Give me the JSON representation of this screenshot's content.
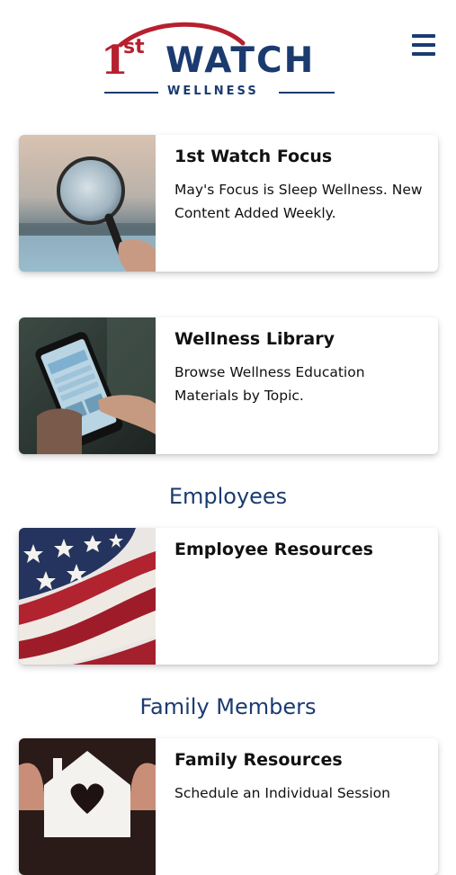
{
  "header": {
    "logo": {
      "number": "1",
      "superscript": "st",
      "brand": "WATCH",
      "tagline": "WELLNESS"
    },
    "menu_icon": "hamburger-menu-icon"
  },
  "colors": {
    "brand_navy": "#1b3b6f",
    "brand_red": "#b7202e"
  },
  "cards": [
    {
      "title": "1st Watch Focus",
      "description": "May's Focus is Sleep Wellness. New Content Added Weekly.",
      "image": "magnifying-glass-image"
    },
    {
      "title": "Wellness Library",
      "description": "Browse Wellness Education Materials by Topic.",
      "image": "phone-library-image"
    }
  ],
  "sections": [
    {
      "heading": "Employees",
      "cards": [
        {
          "title": "Employee Resources",
          "description": "",
          "image": "american-flag-image"
        }
      ]
    },
    {
      "heading": "Family Members",
      "cards": [
        {
          "title": "Family Resources",
          "description": "Schedule an Individual Session",
          "image": "house-heart-image"
        }
      ]
    }
  ]
}
